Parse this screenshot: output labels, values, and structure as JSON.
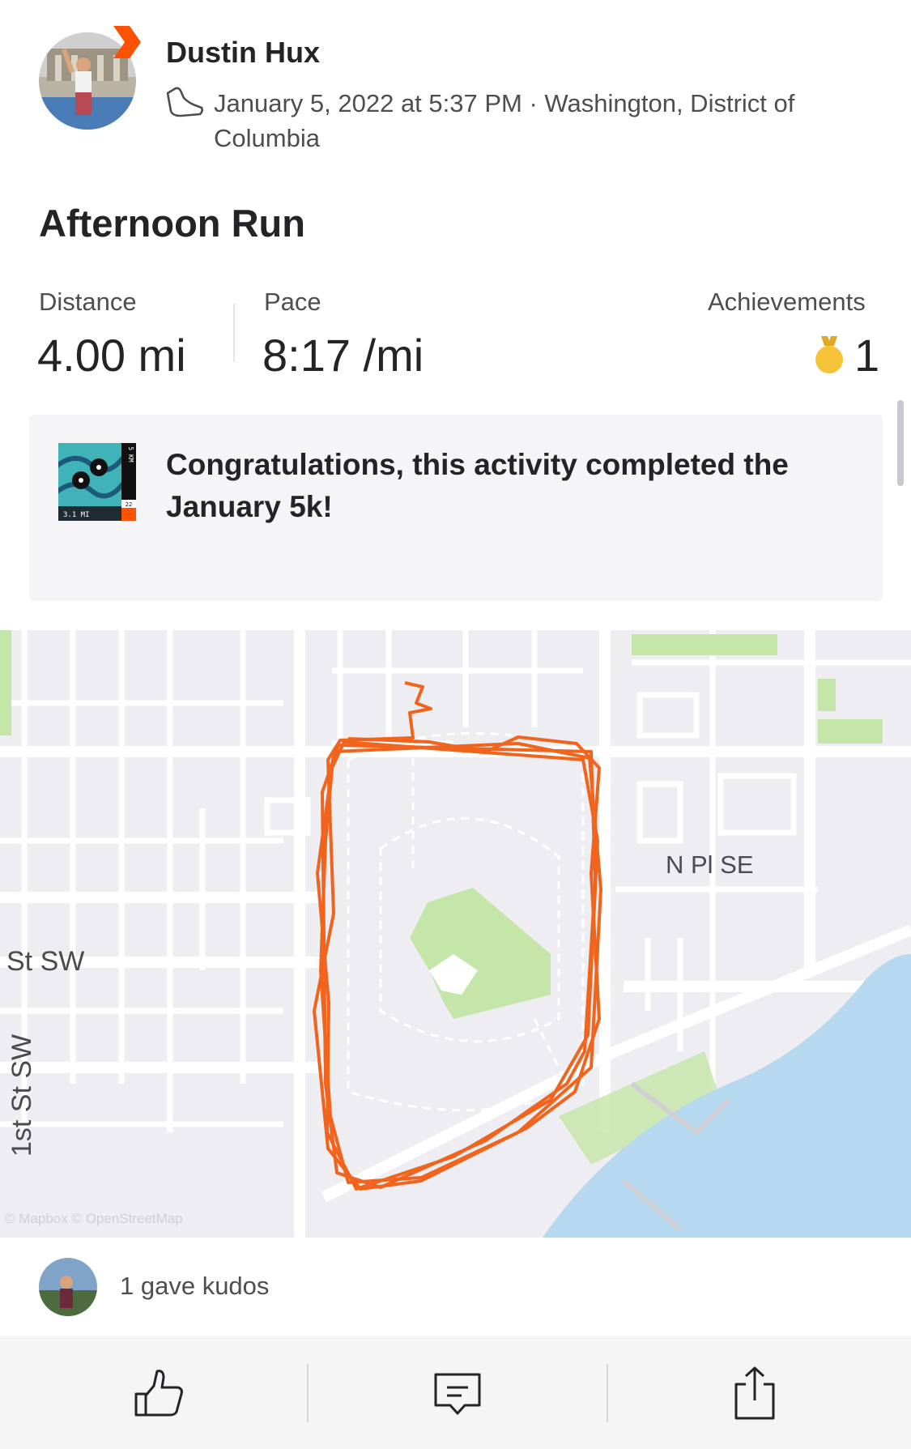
{
  "header": {
    "athlete_name": "Dustin Hux",
    "meta": "January 5, 2022 at 5:37 PM · Washington, District of Columbia"
  },
  "activity": {
    "title": "Afternoon Run",
    "stats": [
      {
        "label": "Distance",
        "value": "4.00 mi"
      },
      {
        "label": "Pace",
        "value": "8:17 /mi"
      },
      {
        "label": "Achievements",
        "value": "1"
      }
    ]
  },
  "challenge": {
    "message": "Congratulations, this activity completed the January 5k!",
    "badge_text_km": "5 KM",
    "badge_text_mi": "3.1 MI",
    "badge_text_year": "22"
  },
  "map": {
    "street_labels": [
      "N Pl SE",
      "St SW",
      "1st St SW"
    ],
    "attribution": "© Mapbox © OpenStreetMap"
  },
  "kudos": {
    "text": "1 gave kudos"
  },
  "colors": {
    "brand_orange": "#fc5200",
    "route": "#f0641e",
    "map_green": "#c4e6a8",
    "water": "#b7d9f0",
    "medal_gold": "#f5c338"
  },
  "icons": {
    "shoe": "shoe-icon",
    "medal": "medal-icon",
    "kudos": "thumbs-up-icon",
    "comment": "comment-icon",
    "share": "share-icon"
  }
}
